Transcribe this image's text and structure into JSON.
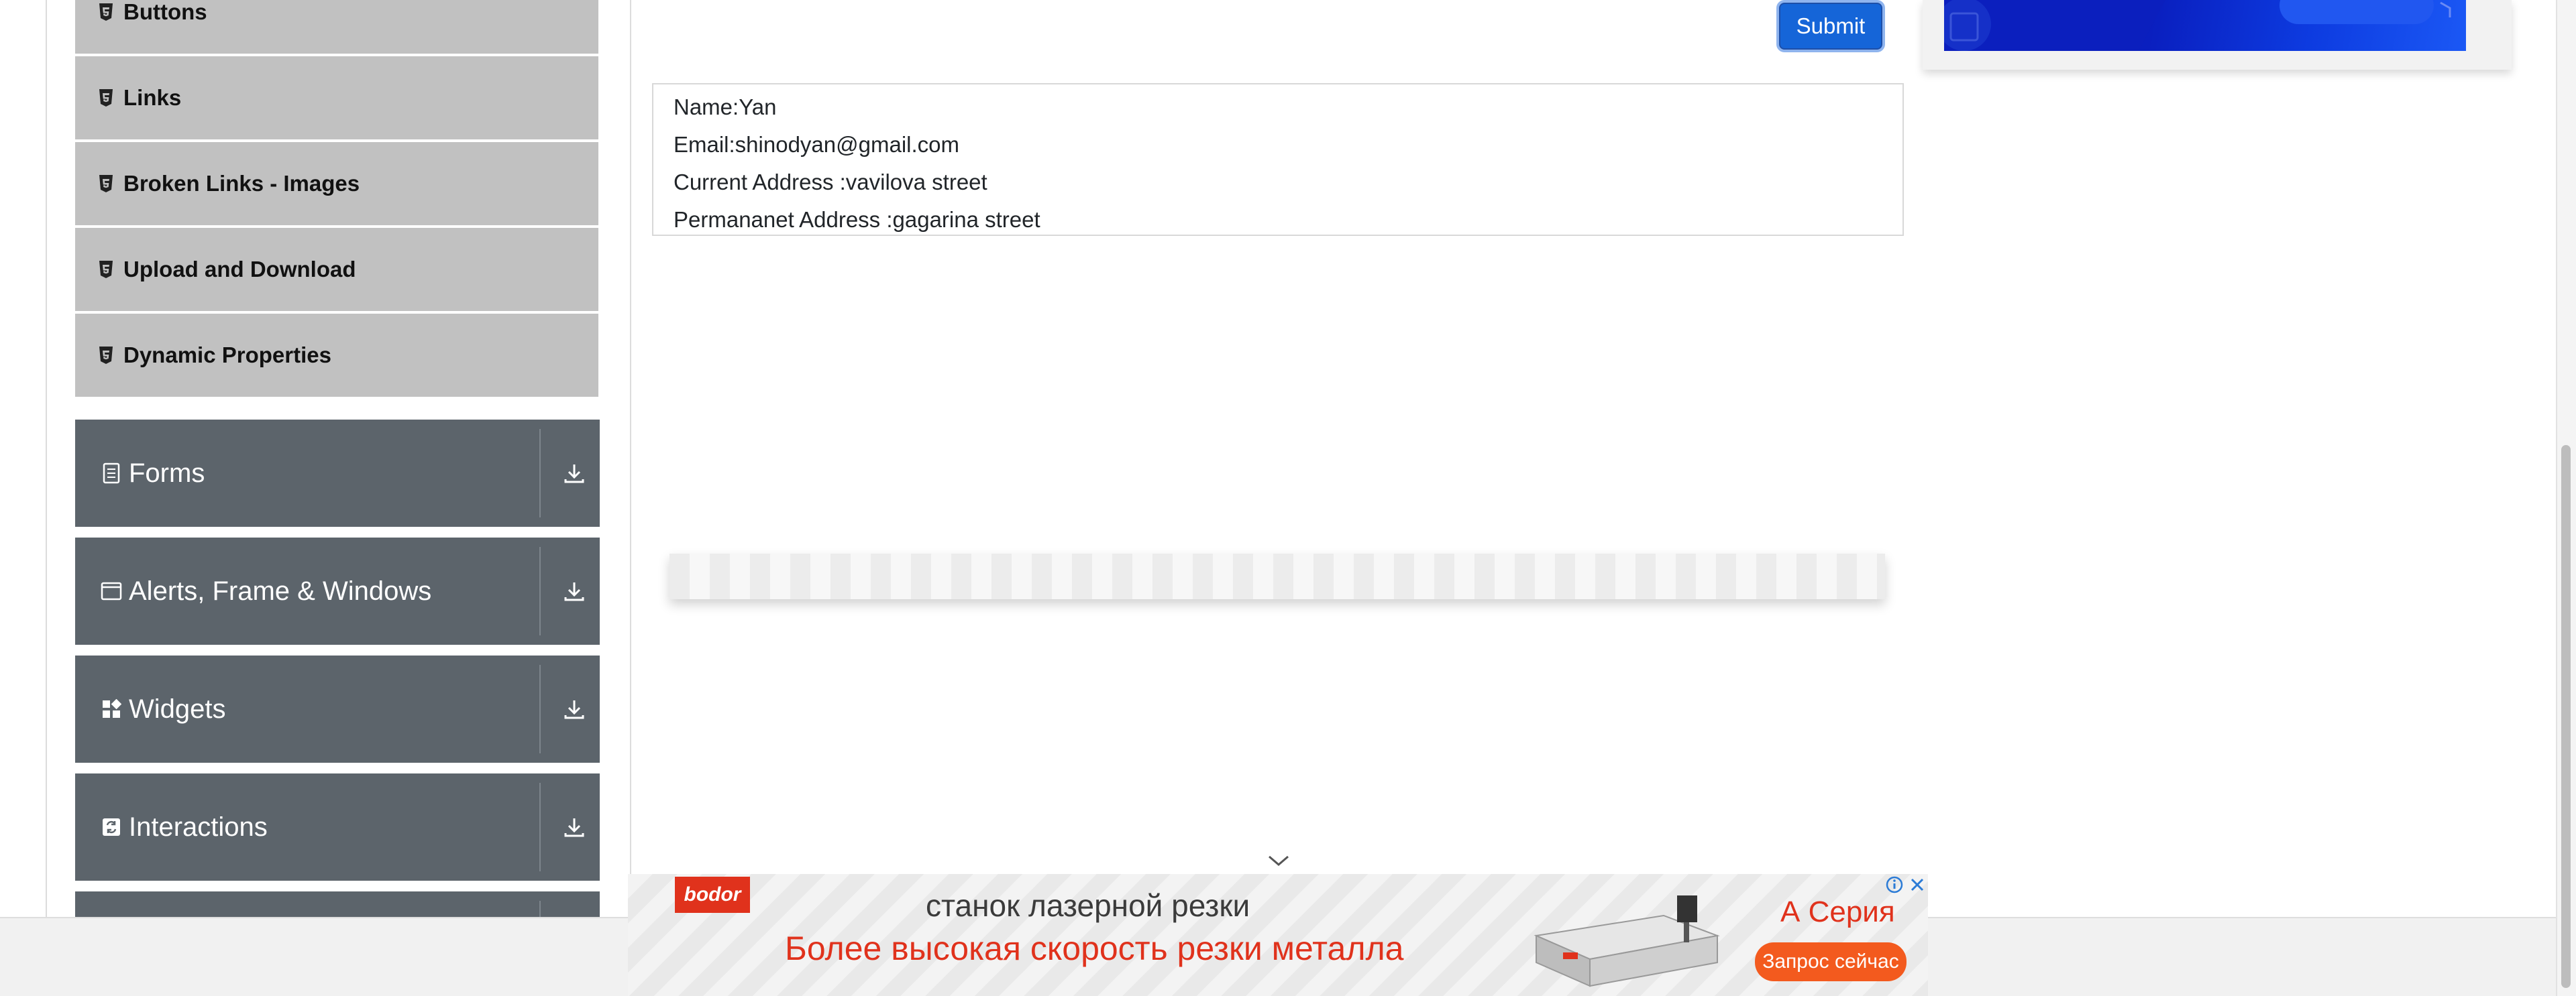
{
  "sidebar": {
    "sub_items": [
      {
        "label": "Buttons",
        "icon": "html5-icon"
      },
      {
        "label": "Links",
        "icon": "html5-icon"
      },
      {
        "label": "Broken Links - Images",
        "icon": "html5-icon"
      },
      {
        "label": "Upload and Download",
        "icon": "html5-icon"
      },
      {
        "label": "Dynamic Properties",
        "icon": "html5-icon"
      }
    ],
    "groups": [
      {
        "label": "Forms",
        "icon": "form-icon"
      },
      {
        "label": "Alerts, Frame & Windows",
        "icon": "window-icon"
      },
      {
        "label": "Widgets",
        "icon": "widgets-icon"
      },
      {
        "label": "Interactions",
        "icon": "interactions-icon"
      }
    ]
  },
  "form": {
    "submit_label": "Submit"
  },
  "output": {
    "name": "Name:Yan",
    "email": "Email:shinodyan@gmail.com",
    "current_address": "Current Address :vavilova street",
    "permanent_address": "Permananet Address :gagarina street"
  },
  "ad": {
    "logo": "bodor",
    "line1": "станок лазерной резки",
    "line2": "Более высокая скорость резки металла",
    "series": "А Серия",
    "cta": "Запрос сейчас"
  },
  "colors": {
    "sub_item_bg": "#c1c1c1",
    "group_bg": "#5c646b",
    "submit_bg": "#1565d8",
    "ad_accent": "#e0321c"
  }
}
